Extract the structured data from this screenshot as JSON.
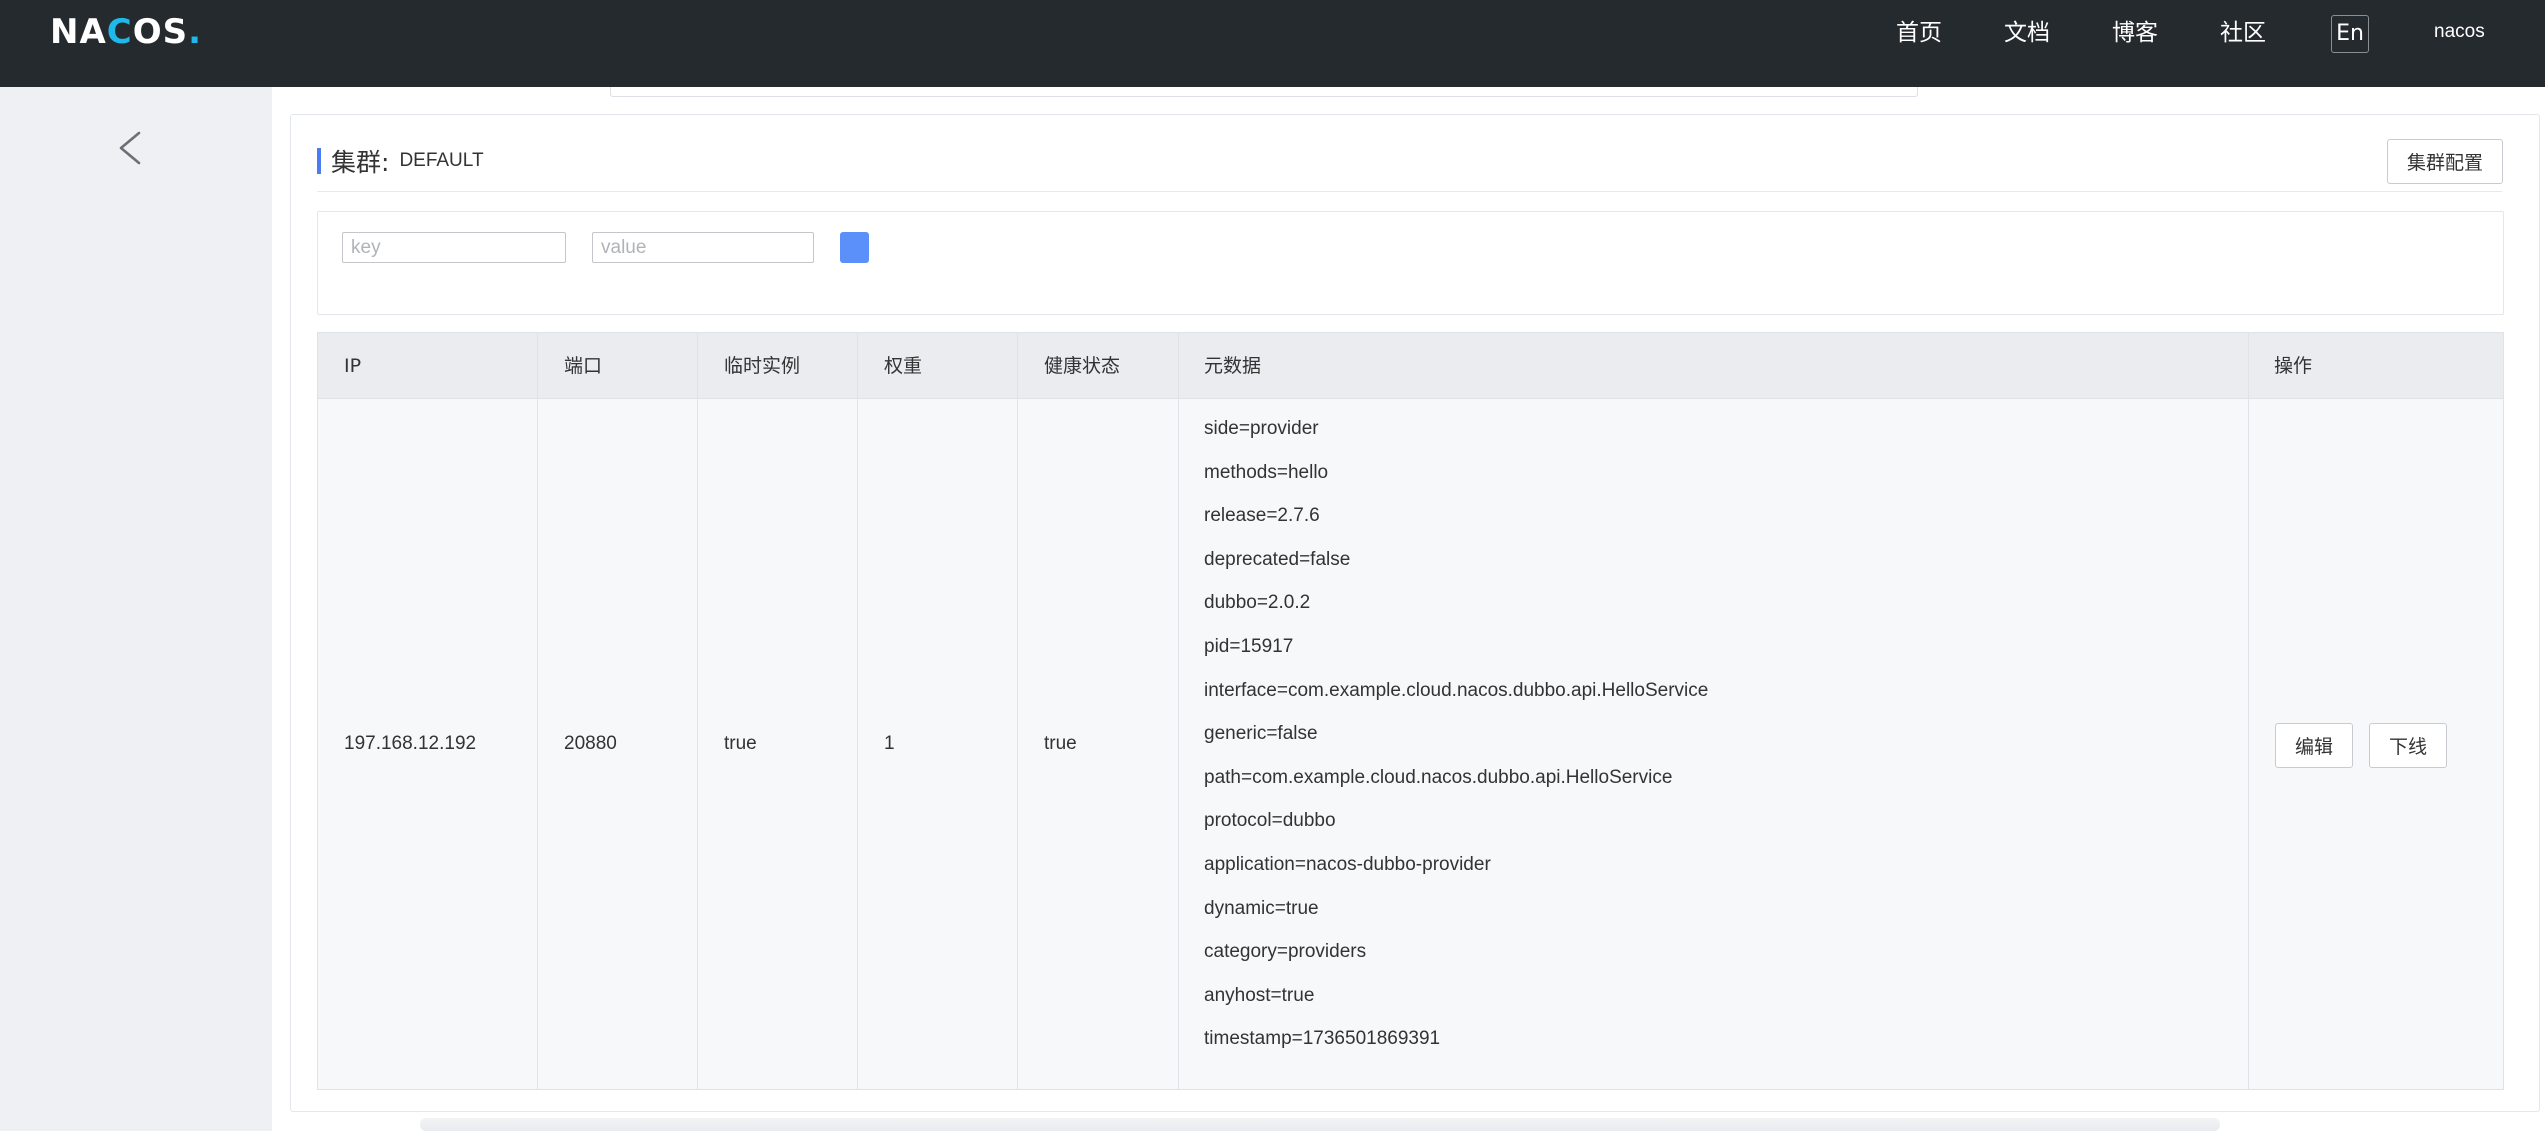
{
  "header": {
    "logo": {
      "left": "NA",
      "accent": "C",
      "right": "OS",
      "dot": "."
    },
    "nav": [
      "首页",
      "文档",
      "博客",
      "社区"
    ],
    "lang_toggle": "En",
    "user": "nacos"
  },
  "cluster": {
    "label": "集群:",
    "name": "DEFAULT",
    "config_button": "集群配置"
  },
  "filter": {
    "key_placeholder": "key",
    "value_placeholder": "value"
  },
  "table": {
    "columns": [
      "IP",
      "端口",
      "临时实例",
      "权重",
      "健康状态",
      "元数据",
      "操作"
    ],
    "row": {
      "ip": "197.168.12.192",
      "port": "20880",
      "ephemeral": "true",
      "weight": "1",
      "healthy": "true",
      "metadata": [
        "side=provider",
        "methods=hello",
        "release=2.7.6",
        "deprecated=false",
        "dubbo=2.0.2",
        "pid=15917",
        "interface=com.example.cloud.nacos.dubbo.api.HelloService",
        "generic=false",
        "path=com.example.cloud.nacos.dubbo.api.HelloService",
        "protocol=dubbo",
        "application=nacos-dubbo-provider",
        "dynamic=true",
        "category=providers",
        "anyhost=true",
        "timestamp=1736501869391"
      ],
      "actions": {
        "edit": "编辑",
        "offline": "下线"
      }
    }
  },
  "colors": {
    "topbar": "#252a2f",
    "accent": "#4a7cf6",
    "logo_accent": "#1fb8ea",
    "add_button": "#5b8ff9"
  },
  "icons": {
    "back": "chevron-left-icon"
  }
}
